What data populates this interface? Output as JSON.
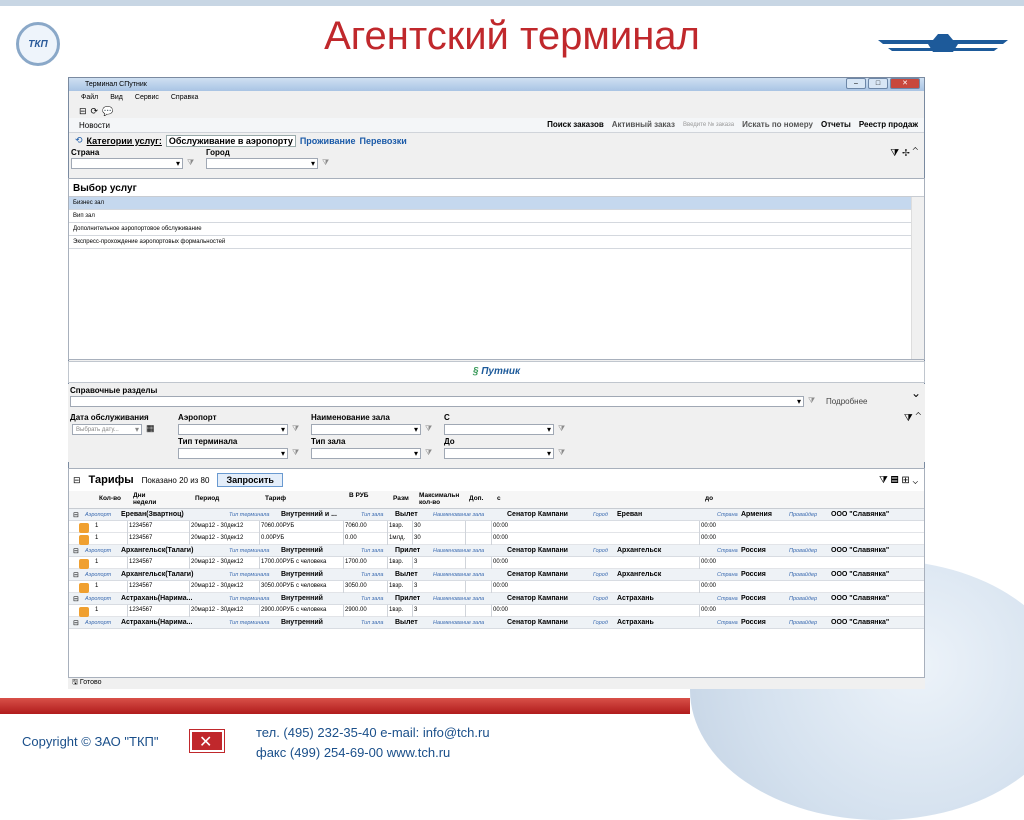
{
  "slide": {
    "title": "Агентский терминал",
    "logo_left_text": "ТКП",
    "copyright": "Copyright © ЗАО \"ТКП\"",
    "phone_line": "тел.  (495) 232-35-40    e-mail: info@tch.ru",
    "fax_line": "факс (499) 254-69-00    www.tch.ru"
  },
  "window": {
    "title": "Терминал СПутник",
    "menu": [
      "Файл",
      "Вид",
      "Сервис",
      "Справка"
    ],
    "news": "Новости",
    "toolbar": {
      "search_orders": "Поиск заказов",
      "active_order": "Активный заказ",
      "order_placeholder": "Введите № заказа",
      "search_by_number": "Искать по номеру",
      "reports": "Отчеты",
      "sales_registry": "Реестр продаж"
    },
    "categories_label": "Категории услуг:",
    "category_tabs": [
      "Обслуживание в аэропорту",
      "Проживание",
      "Перевозки"
    ],
    "country_label": "Страна",
    "city_label": "Город",
    "services_title": "Выбор услуг",
    "services": [
      "Бизнес зал",
      "Вип зал",
      "Дополнительное аэропортовое обслуживание",
      "Экспресс-прохождение аэропортовых формальностей"
    ],
    "brand": "Путник",
    "ref_label": "Справочные разделы",
    "more": "Подробнее",
    "filters": {
      "service_date": "Дата обслуживания",
      "date_placeholder": "Выбрать дату...",
      "airport": "Аэропорт",
      "terminal_type": "Тип терминала",
      "hall_name": "Наименование зала",
      "hall_type": "Тип зала",
      "from": "С",
      "to": "До"
    },
    "tariffs": {
      "title": "Тарифы",
      "shown": "Показано 20 из 80",
      "request_button": "Запросить",
      "columns": [
        "Кол-во",
        "Дни недели",
        "Период",
        "Тариф",
        "В РУБ",
        "Разм",
        "Максимальн кол-во",
        "Доп.",
        "с",
        "до"
      ],
      "group_labels": {
        "airport": "Аэропорт",
        "terminal": "Тип терминала",
        "hall_type": "Тип зала",
        "hall_name": "Наименование зала",
        "city": "Город",
        "country": "Страна",
        "provider": "Провайдер"
      },
      "groups": [
        {
          "airport": "Ереван(Звартноц)",
          "terminal": "Внутренний и ...",
          "hall_type": "Вылет",
          "hall": "Сенатор Кампани",
          "city": "Ереван",
          "country": "Армения",
          "provider": "ООО \"Славянка\"",
          "rows": [
            {
              "qty": "1",
              "days": "1234567",
              "period": "20мар12 - 30дек12",
              "tariff": "7060.00РУБ",
              "rub": "7060.00",
              "size": "1взр.",
              "max": "30",
              "from": "00:00",
              "to": "00:00"
            },
            {
              "qty": "1",
              "days": "1234567",
              "period": "20мар12 - 30дек12",
              "tariff": "0.00РУБ",
              "rub": "0.00",
              "size": "1млд.",
              "max": "30",
              "from": "00:00",
              "to": "00:00"
            }
          ]
        },
        {
          "airport": "Архангельск(Талаги)",
          "terminal": "Внутренний",
          "hall_type": "Прилет",
          "hall": "Сенатор Кампани",
          "city": "Архангельск",
          "country": "Россия",
          "provider": "ООО \"Славянка\"",
          "rows": [
            {
              "qty": "1",
              "days": "1234567",
              "period": "20мар12 - 30дек12",
              "tariff": "1700.00РУБ с человека",
              "rub": "1700.00",
              "size": "1взр.",
              "max": "3",
              "from": "00:00",
              "to": "00:00"
            }
          ]
        },
        {
          "airport": "Архангельск(Талаги)",
          "terminal": "Внутренний",
          "hall_type": "Вылет",
          "hall": "Сенатор Кампани",
          "city": "Архангельск",
          "country": "Россия",
          "provider": "ООО \"Славянка\"",
          "rows": [
            {
              "qty": "1",
              "days": "1234567",
              "period": "20мар12 - 30дек12",
              "tariff": "3050.00РУБ с человека",
              "rub": "3050.00",
              "size": "1взр.",
              "max": "3",
              "from": "00:00",
              "to": "00:00"
            }
          ]
        },
        {
          "airport": "Астрахань(Нарима...",
          "terminal": "Внутренний",
          "hall_type": "Прилет",
          "hall": "Сенатор Кампани",
          "city": "Астрахань",
          "country": "Россия",
          "provider": "ООО \"Славянка\"",
          "rows": [
            {
              "qty": "1",
              "days": "1234567",
              "period": "20мар12 - 30дек12",
              "tariff": "2900.00РУБ с человека",
              "rub": "2900.00",
              "size": "1взр.",
              "max": "3",
              "from": "00:00",
              "to": "00:00"
            }
          ]
        },
        {
          "airport": "Астрахань(Нарима...",
          "terminal": "Внутренний",
          "hall_type": "Вылет",
          "hall": "Сенатор Кампани",
          "city": "Астрахань",
          "country": "Россия",
          "provider": "ООО \"Славянка\"",
          "rows": []
        }
      ]
    },
    "status": "Готово"
  }
}
